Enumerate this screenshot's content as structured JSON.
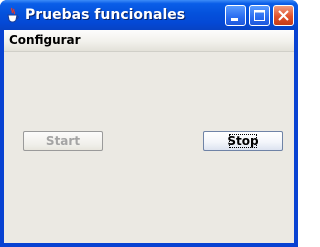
{
  "window": {
    "title": "Pruebas funcionales",
    "app_icon": "java-cup-icon",
    "controls": [
      "minimize-icon",
      "maximize-icon",
      "close-icon"
    ]
  },
  "menubar": {
    "items": [
      {
        "label": "Configurar"
      }
    ]
  },
  "buttons": {
    "start_label": "Start",
    "start_enabled": false,
    "stop_label": "Stop",
    "stop_focused": true
  },
  "colors": {
    "titlebar": "#0451dc",
    "window_bg": "#ebe9e3",
    "close_button": "#e1522c"
  }
}
